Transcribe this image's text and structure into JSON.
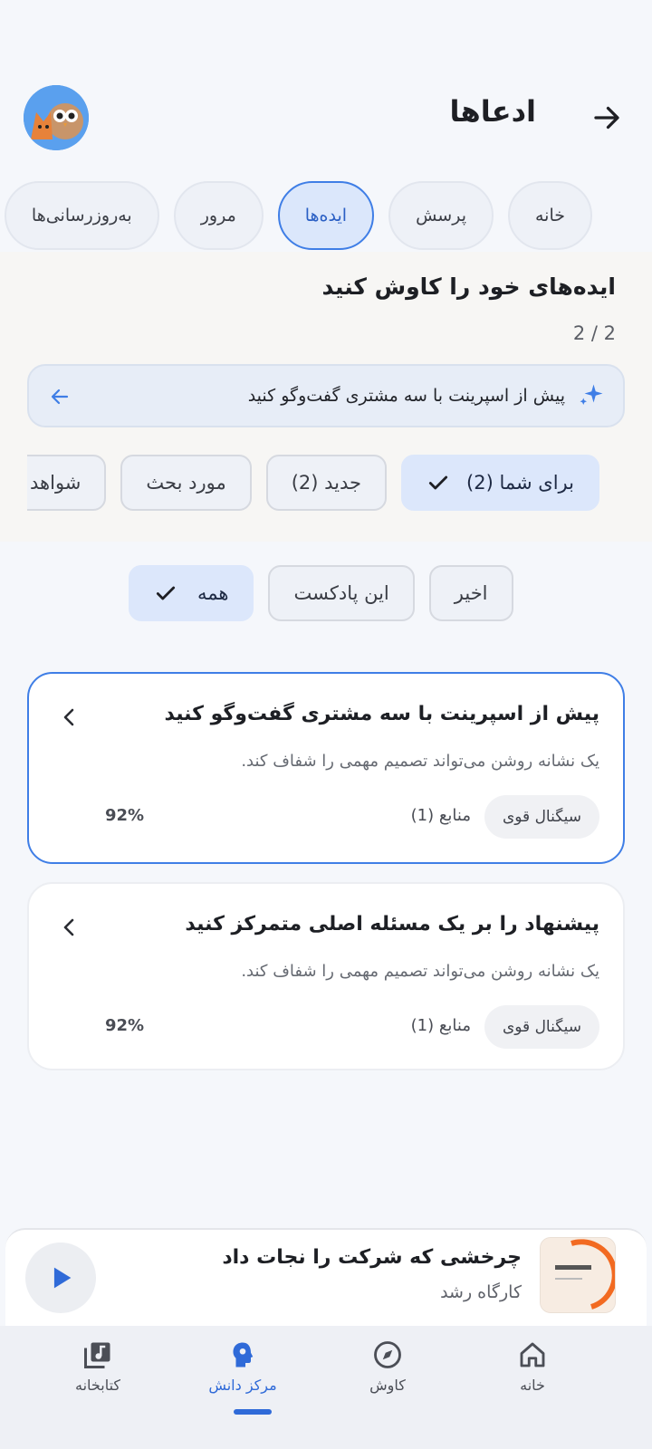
{
  "header": {
    "title": "ادعاها",
    "back_icon": "arrow-right-icon",
    "avatar_icon": "owl-fox-avatar"
  },
  "tabs": [
    {
      "label": "خانه",
      "active": false
    },
    {
      "label": "پرسش",
      "active": false
    },
    {
      "label": "ایده‌ها",
      "active": true
    },
    {
      "label": "مرور",
      "active": false
    },
    {
      "label": "به‌روزرسانی‌ها",
      "active": false
    }
  ],
  "ideas": {
    "title": "ایده‌های خود را کاوش کنید",
    "count": "2 / 2",
    "banner_text": "پیش از اسپرینت با سه مشتری گفت‌وگو کنید"
  },
  "chips": [
    {
      "label": "برای شما (2)",
      "active": true
    },
    {
      "label": "جدید (2)",
      "active": false
    },
    {
      "label": "مورد بحث",
      "active": false
    },
    {
      "label": "شواهد",
      "active": false
    }
  ],
  "filters": [
    {
      "label": "همه",
      "active": true
    },
    {
      "label": "این پادکست",
      "active": false
    },
    {
      "label": "اخیر",
      "active": false
    }
  ],
  "cards": [
    {
      "title": "پیش از اسپرینت با سه مشتری گفت‌وگو کنید",
      "description": "یک نشانه روشن می‌تواند تصمیم مهمی را شفاف کند.",
      "badge": "سیگنال قوی",
      "sources": "منابع (1)",
      "confidence": "92%",
      "selected": true
    },
    {
      "title": "پیشنهاد را بر یک مسئله اصلی متمرکز کنید",
      "description": "یک نشانه روشن می‌تواند تصمیم مهمی را شفاف کند.",
      "badge": "سیگنال قوی",
      "sources": "منابع (1)",
      "confidence": "92%",
      "selected": false
    }
  ],
  "player": {
    "title": "چرخشی که شرکت را نجات داد",
    "subtitle": "کارگاه رشد",
    "play_icon": "play-icon"
  },
  "nav": [
    {
      "label": "خانه",
      "icon": "home-icon",
      "active": false
    },
    {
      "label": "کاوش",
      "icon": "compass-icon",
      "active": false
    },
    {
      "label": "مرکز دانش",
      "icon": "brain-head-icon",
      "active": true
    },
    {
      "label": "کتابخانه",
      "icon": "library-music-icon",
      "active": false
    }
  ],
  "colors": {
    "accent": "#3f7ee6",
    "background": "#f5f7fb"
  }
}
